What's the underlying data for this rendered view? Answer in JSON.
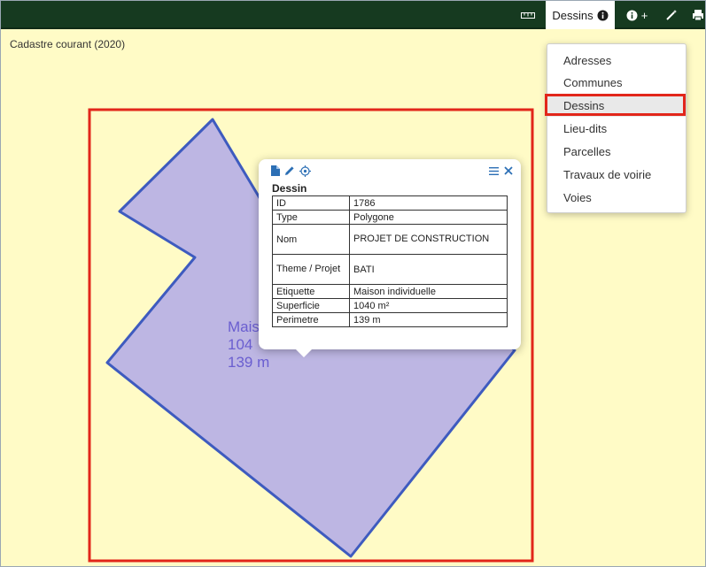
{
  "colors": {
    "toolbar_bg": "#163a20",
    "map_bg": "#fffbc6",
    "polygon_fill": "#bdb6e3",
    "polygon_stroke": "#3e5bbf",
    "selection_box": "#e2261a",
    "accent_icons": "#2c6fb5"
  },
  "toolbar": {
    "ruler_icon": "ruler-icon",
    "active_tab": "Dessins",
    "info_plus_label": "+",
    "wand_icon": "magic-wand-icon",
    "print_icon": "print-icon"
  },
  "map": {
    "coverage_label": "Cadastre courant (2020)",
    "polygon_label": {
      "line1": "Mais",
      "line2": "104",
      "line3": "139 m"
    }
  },
  "layer_menu": {
    "items": [
      {
        "label": "Adresses"
      },
      {
        "label": "Communes"
      },
      {
        "label": "Dessins",
        "active": true
      },
      {
        "label": "Lieu-dits"
      },
      {
        "label": "Parcelles"
      },
      {
        "label": "Travaux de voirie"
      },
      {
        "label": "Voies"
      }
    ]
  },
  "popup": {
    "title": "Dessin",
    "rows": [
      {
        "key": "ID",
        "value": "1786"
      },
      {
        "key": "Type",
        "value": "Polygone"
      },
      {
        "key": "Nom",
        "value": "PROJET DE CONSTRUCTION"
      },
      {
        "key": "Theme / Projet",
        "value": "BATI"
      },
      {
        "key": "Etiquette",
        "value": "Maison individuelle"
      },
      {
        "key": "Superficie",
        "value": "1040 m²"
      },
      {
        "key": "Perimetre",
        "value": "139 m"
      }
    ]
  }
}
